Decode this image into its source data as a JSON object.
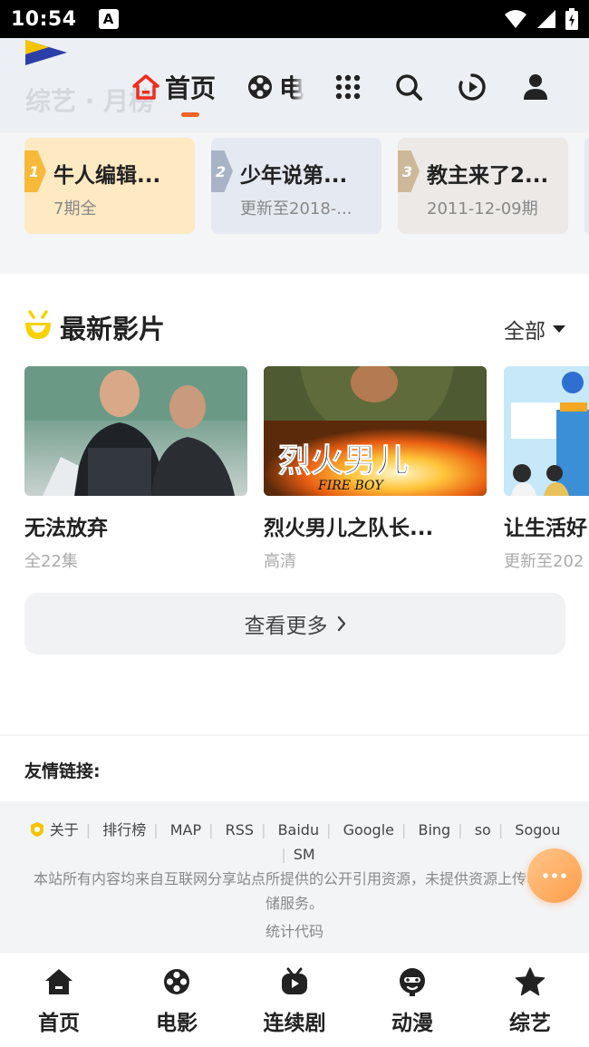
{
  "status": {
    "time": "10:54",
    "notif_icon": "A"
  },
  "header": {
    "ghost_text": "综艺 · 月榜",
    "tabs": [
      {
        "label": "首页",
        "icon": "home-icon",
        "active": true
      },
      {
        "label": "电",
        "icon": "film-reel-icon",
        "active": false
      }
    ],
    "accent": "#f06423"
  },
  "ranking": [
    {
      "rank": "1",
      "title": "牛人编辑...",
      "subtitle": "7期全",
      "bg": "#fde9c2",
      "badge": "#f6b93a"
    },
    {
      "rank": "2",
      "title": "少年说第...",
      "subtitle": "更新至2018-...",
      "bg": "#e5e9f1",
      "badge": "#a9b3c6"
    },
    {
      "rank": "3",
      "title": "教主来了2...",
      "subtitle": "2011-12-09期",
      "bg": "#ece9e6",
      "badge": "#cdb89a"
    }
  ],
  "section": {
    "title": "最新影片",
    "filter": "全部"
  },
  "movies": [
    {
      "title": "无法放弃",
      "subtitle": "全22集"
    },
    {
      "title": "烈火男儿之队长...",
      "subtitle": "高清",
      "poster_text": "烈火男儿",
      "poster_sub": "FIRE BOY"
    },
    {
      "title": "让生活好",
      "subtitle": "更新至202"
    }
  ],
  "more_button": {
    "label": "查看更多"
  },
  "friends_label": "友情链接:",
  "footer": {
    "links": [
      "关于",
      "排行榜",
      "MAP",
      "RSS",
      "Baidu",
      "Google",
      "Bing",
      "so",
      "Sogou",
      "SM"
    ],
    "disclaimer": "本站所有内容均来自互联网分享站点所提供的公开引用资源，未提供资源上传、存储服务。",
    "stats": "统计代码"
  },
  "tabbar": [
    {
      "label": "首页",
      "icon": "home-icon"
    },
    {
      "label": "电影",
      "icon": "film-reel-icon"
    },
    {
      "label": "连续剧",
      "icon": "tv-icon"
    },
    {
      "label": "动漫",
      "icon": "anime-face-icon"
    },
    {
      "label": "综艺",
      "icon": "star-icon"
    }
  ]
}
